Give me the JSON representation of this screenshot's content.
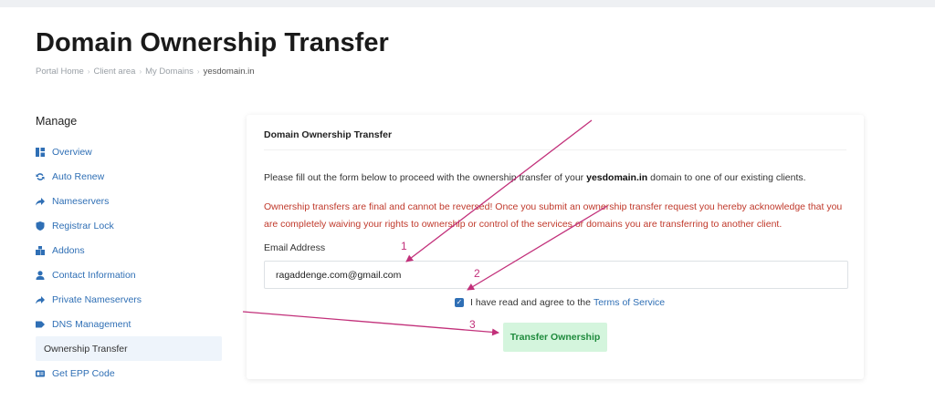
{
  "page": {
    "title": "Domain Ownership Transfer"
  },
  "breadcrumb": {
    "items": [
      "Portal Home",
      "Client area",
      "My Domains"
    ],
    "current": "yesdomain.in"
  },
  "sidebar": {
    "title": "Manage",
    "items": [
      {
        "label": "Overview",
        "icon": "dashboard-icon"
      },
      {
        "label": "Auto Renew",
        "icon": "sync-icon"
      },
      {
        "label": "Nameservers",
        "icon": "share-arrow-icon"
      },
      {
        "label": "Registrar Lock",
        "icon": "shield-icon"
      },
      {
        "label": "Addons",
        "icon": "cubes-icon"
      },
      {
        "label": "Contact Information",
        "icon": "user-icon"
      },
      {
        "label": "Private Nameservers",
        "icon": "share-arrow-icon"
      },
      {
        "label": "DNS Management",
        "icon": "tag-icon"
      },
      {
        "label": "Ownership Transfer",
        "icon": ""
      },
      {
        "label": "Get EPP Code",
        "icon": "id-card-icon"
      }
    ],
    "active_index": 8
  },
  "card": {
    "title": "Domain Ownership Transfer",
    "intro_before": "Please fill out the form below to proceed with the ownership transfer of your",
    "intro_domain": "yesdomain.in",
    "intro_after": "domain to one of our existing clients.",
    "warning": "Ownership transfers are final and cannot be reversed! Once you submit an ownership transfer request you hereby acknowledge that you are completely waiving your rights to ownership or control of the services or domains you are transferring to another client.",
    "email_label": "Email Address",
    "email_value": "ragaddenge.com@gmail.com",
    "tos_text": "I have read and agree to the",
    "tos_link": "Terms of Service",
    "tos_checked": true,
    "submit_label": "Transfer Ownership"
  },
  "annotations": {
    "step1": "1",
    "step2": "2",
    "step3": "3",
    "color": "#c2307a"
  },
  "colors": {
    "link": "#2f6fb5",
    "warning": "#c0392b",
    "button_bg": "#d4f5dd",
    "button_text": "#1e8a3c"
  }
}
